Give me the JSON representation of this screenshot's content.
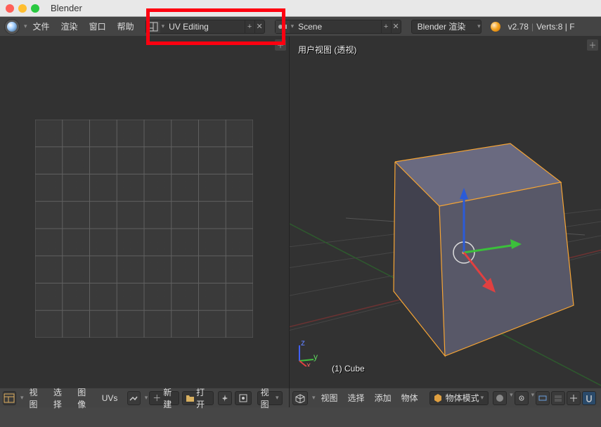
{
  "titlebar": {
    "title": "Blender"
  },
  "topbar": {
    "menus": [
      "文件",
      "渲染",
      "窗口",
      "帮助"
    ],
    "layout": {
      "label": "UV Editing"
    },
    "scene": {
      "label": "Scene"
    },
    "engine": {
      "label": "Blender 渲染"
    },
    "version": "v2.78",
    "stats": "Verts:8 | F"
  },
  "viewport3d": {
    "header": "用户视图 (透视)",
    "object_name": "(1) Cube"
  },
  "footerL": {
    "menus": [
      "视图",
      "选择",
      "图像",
      "UVs"
    ],
    "newbtn": "新建",
    "openbtn": "打开",
    "viewlbl": "视图"
  },
  "footerR": {
    "menus": [
      "视图",
      "选择",
      "添加",
      "物体"
    ],
    "mode": "物体模式"
  }
}
